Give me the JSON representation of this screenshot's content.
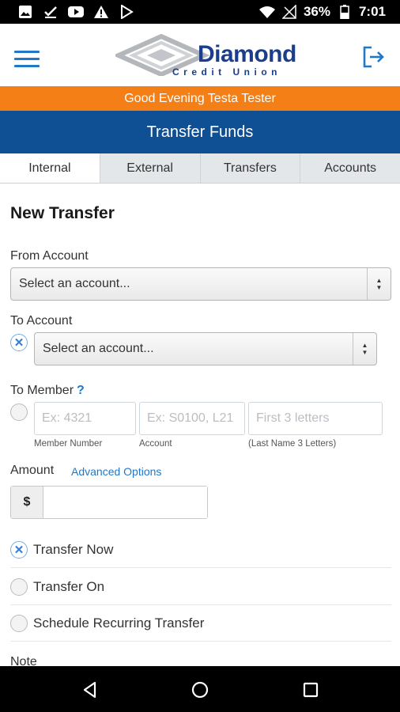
{
  "status_bar": {
    "battery": "36%",
    "time": "7:01",
    "left_icons": [
      "image-icon",
      "check-icon",
      "youtube-icon",
      "warning-icon",
      "play-store-icon"
    ],
    "right_icons": [
      "wifi-icon",
      "no-signal-icon",
      "battery-icon"
    ]
  },
  "header": {
    "logo_brand": "Diamond",
    "logo_subtitle": "Credit Union",
    "brand_color": "#1a3e8c",
    "accent_color": "#1f78c8"
  },
  "greeting": "Good Evening Testa Tester",
  "page_title": "Transfer Funds",
  "tabs": [
    {
      "label": "Internal",
      "active": true
    },
    {
      "label": "External",
      "active": false
    },
    {
      "label": "Transfers",
      "active": false
    },
    {
      "label": "Accounts",
      "active": false
    }
  ],
  "form": {
    "heading": "New Transfer",
    "from_account": {
      "label": "From Account",
      "value": "Select an account..."
    },
    "to_account": {
      "label": "To Account",
      "value": "Select an account...",
      "selected": true
    },
    "to_member": {
      "label": "To Member",
      "help": "?",
      "selected": false,
      "member_number": {
        "placeholder": "Ex: 4321",
        "caption": "Member Number"
      },
      "account": {
        "placeholder": "Ex: S0100, L21",
        "caption": "Account"
      },
      "last_name": {
        "placeholder": "First  3  letters",
        "caption": "(Last Name  3  Letters)"
      }
    },
    "amount": {
      "label": "Amount",
      "advanced_link": "Advanced Options",
      "currency": "$",
      "value": ""
    },
    "options": [
      {
        "label": "Transfer Now",
        "selected": true
      },
      {
        "label": "Transfer On",
        "selected": false
      },
      {
        "label": "Schedule Recurring Transfer",
        "selected": false
      }
    ],
    "note_label": "Note"
  }
}
